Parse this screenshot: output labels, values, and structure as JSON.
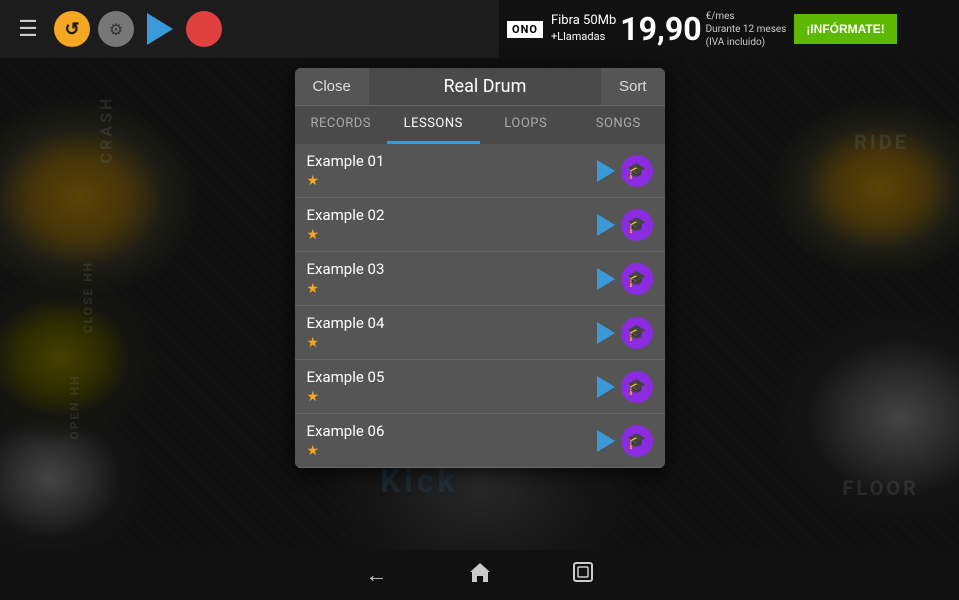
{
  "topbar": {
    "icons": [
      "menu",
      "refresh",
      "settings",
      "play",
      "record"
    ]
  },
  "ad": {
    "logo": "ONO",
    "line1": "Fibra 50Mb",
    "line2": "+Llamadas",
    "price": "19,90",
    "price_suffix": "€/mes",
    "price_note1": "Durante 12 meses",
    "price_note2": "(IVA incluido)",
    "cta": "¡INFÓRMATE!"
  },
  "modal": {
    "close_label": "Close",
    "title": "Real Drum",
    "sort_label": "Sort",
    "tabs": [
      {
        "id": "records",
        "label": "RECORDS",
        "active": false
      },
      {
        "id": "lessons",
        "label": "LESSONS",
        "active": true
      },
      {
        "id": "loops",
        "label": "LOOPS",
        "active": false
      },
      {
        "id": "songs",
        "label": "SONGS",
        "active": false
      }
    ],
    "items": [
      {
        "name": "Example 01",
        "star": "★"
      },
      {
        "name": "Example 02",
        "star": "★"
      },
      {
        "name": "Example 03",
        "star": "★"
      },
      {
        "name": "Example 04",
        "star": "★"
      },
      {
        "name": "Example 05",
        "star": "★"
      },
      {
        "name": "Example 06",
        "star": "★"
      }
    ]
  },
  "drum_labels": {
    "crash": "CRASH",
    "close_hh": "CLOSE HH",
    "open_hh": "OPEN HH",
    "kick": "Kick",
    "ride": "RIDE",
    "floor": "FLOOR"
  },
  "bottom_nav": {
    "back": "←",
    "home": "⌂",
    "recent": "▣"
  }
}
